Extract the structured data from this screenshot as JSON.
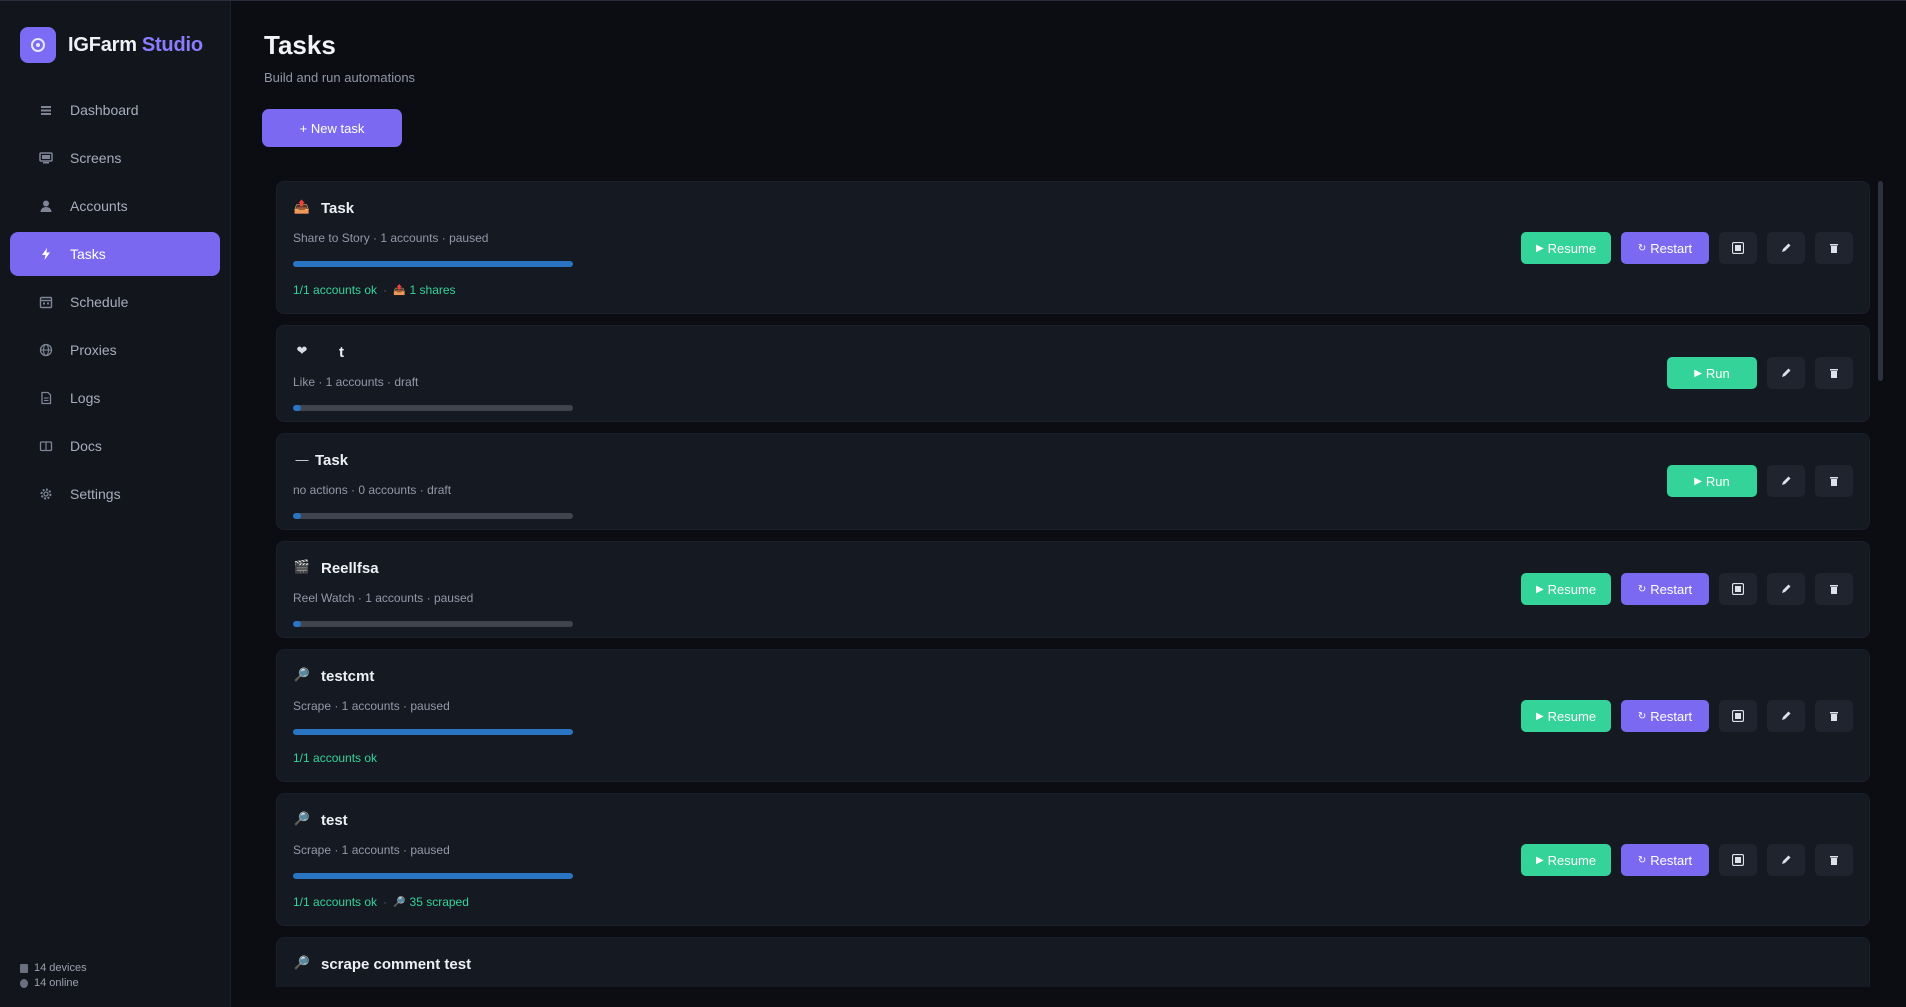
{
  "brand": {
    "name": "IGFarm",
    "accent": "Studio"
  },
  "sidebar": {
    "items": [
      {
        "label": "Dashboard",
        "icon": "dashboard-icon",
        "active": false
      },
      {
        "label": "Screens",
        "icon": "screens-icon",
        "active": false
      },
      {
        "label": "Accounts",
        "icon": "accounts-icon",
        "active": false
      },
      {
        "label": "Tasks",
        "icon": "bolt-icon",
        "active": true
      },
      {
        "label": "Schedule",
        "icon": "calendar-icon",
        "active": false
      },
      {
        "label": "Proxies",
        "icon": "globe-icon",
        "active": false
      },
      {
        "label": "Logs",
        "icon": "document-icon",
        "active": false
      },
      {
        "label": "Docs",
        "icon": "book-icon",
        "active": false
      },
      {
        "label": "Settings",
        "icon": "gear-icon",
        "active": false
      }
    ],
    "footer": {
      "devices": "14 devices",
      "online": "14 online"
    }
  },
  "header": {
    "title": "Tasks",
    "subtitle": "Build and run automations",
    "new_task_label": "+ New task"
  },
  "labels": {
    "resume": "Resume",
    "restart": "Restart",
    "run": "Run"
  },
  "colors": {
    "accent": "#7c69f2",
    "success": "#34d399",
    "progress": "#2a74c4",
    "background": "#0b0d13"
  },
  "tasks": [
    {
      "icon": "share-icon",
      "name": "Task",
      "meta": "Share to Story · 1 accounts · paused",
      "progress": 1.0,
      "status": "paused",
      "stat_ok": "1/1 accounts ok",
      "stat_extra": "1 shares"
    },
    {
      "icon": "heart-icon",
      "name": "t",
      "meta": "Like · 1 accounts · draft",
      "progress": 0.03,
      "status": "draft",
      "stat_ok": "",
      "stat_extra": ""
    },
    {
      "icon": "dash-icon",
      "name": "Task",
      "meta": "no actions · 0 accounts · draft",
      "progress": 0.03,
      "status": "draft",
      "stat_ok": "",
      "stat_extra": ""
    },
    {
      "icon": "clapper-icon",
      "name": "Reellfsa",
      "meta": "Reel Watch · 1 accounts · paused",
      "progress": 0.03,
      "status": "paused",
      "stat_ok": "",
      "stat_extra": ""
    },
    {
      "icon": "search-icon",
      "name": "testcmt",
      "meta": "Scrape · 1 accounts · paused",
      "progress": 1.0,
      "status": "paused",
      "stat_ok": "1/1 accounts ok",
      "stat_extra": ""
    },
    {
      "icon": "search-icon",
      "name": "test",
      "meta": "Scrape · 1 accounts · paused",
      "progress": 1.0,
      "status": "paused",
      "stat_ok": "1/1 accounts ok",
      "stat_extra": "35 scraped"
    },
    {
      "icon": "search-icon",
      "name": "scrape comment test",
      "meta": "",
      "progress": 0,
      "status": "",
      "stat_ok": "",
      "stat_extra": ""
    }
  ]
}
